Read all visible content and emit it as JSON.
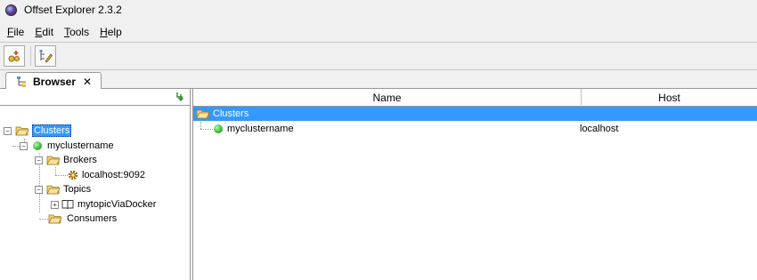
{
  "window": {
    "title": "Offset Explorer  2.3.2"
  },
  "menu": [
    {
      "key": "F",
      "rest": "ile"
    },
    {
      "key": "E",
      "rest": "dit"
    },
    {
      "key": "T",
      "rest": "ools"
    },
    {
      "key": "H",
      "rest": "elp"
    }
  ],
  "toolbar": {
    "add_cluster_icon": "add-cluster-icon",
    "edit_icon": "edit-tree-icon"
  },
  "tab": {
    "label": "Browser",
    "close": "✕"
  },
  "tree": {
    "root": "Clusters",
    "cluster": "myclustername",
    "brokers": "Brokers",
    "broker": "localhost:9092",
    "topics": "Topics",
    "topic": "mytopicViaDocker",
    "consumers": "Consumers"
  },
  "table": {
    "columns": [
      "Name",
      "Host"
    ],
    "rows": [
      {
        "name": "Clusters",
        "host": ""
      },
      {
        "name": "myclustername",
        "host": "localhost"
      }
    ]
  },
  "colors": {
    "selection": "#3399ff",
    "status_ok": "#3fbf3a",
    "folder": "#e8b84a"
  }
}
